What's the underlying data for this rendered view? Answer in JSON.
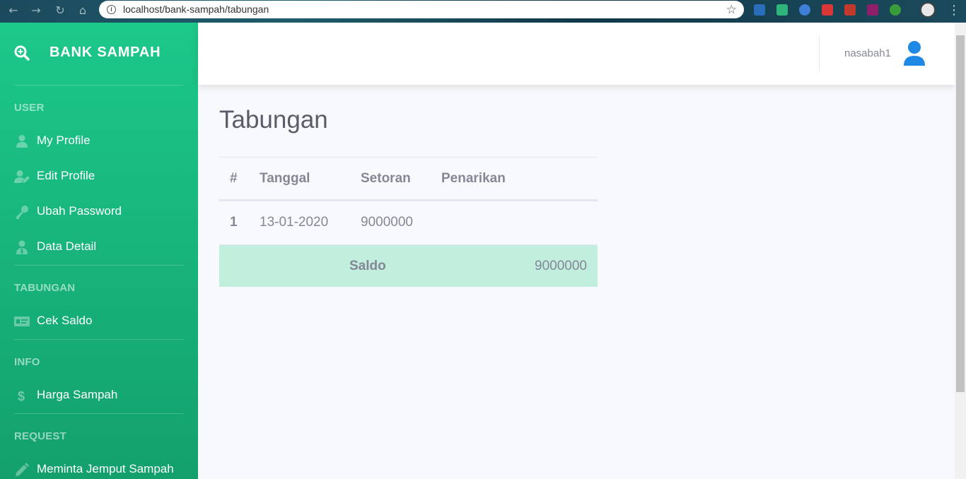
{
  "browser": {
    "url": "localhost/bank-sampah/tabungan"
  },
  "sidebar": {
    "brand": "BANK SAMPAH",
    "sections": [
      {
        "heading": "USER",
        "items": [
          {
            "label": "My Profile",
            "icon": "user-icon"
          },
          {
            "label": "Edit Profile",
            "icon": "user-edit-icon"
          },
          {
            "label": "Ubah Password",
            "icon": "key-icon"
          },
          {
            "label": "Data Detail",
            "icon": "user-tie-icon"
          }
        ]
      },
      {
        "heading": "TABUNGAN",
        "items": [
          {
            "label": "Cek Saldo",
            "icon": "id-card-icon"
          }
        ]
      },
      {
        "heading": "INFO",
        "items": [
          {
            "label": "Harga Sampah",
            "icon": "dollar-icon"
          }
        ]
      },
      {
        "heading": "REQUEST",
        "items": [
          {
            "label": "Meminta Jemput Sampah",
            "icon": "pencil-icon"
          }
        ]
      }
    ]
  },
  "topbar": {
    "username": "nasabah1"
  },
  "main": {
    "title": "Tabungan",
    "table": {
      "headers": [
        "#",
        "Tanggal",
        "Setoran",
        "Penarikan"
      ],
      "rows": [
        {
          "no": "1",
          "tanggal": "13-01-2020",
          "setoran": "9000000",
          "penarikan": ""
        }
      ],
      "saldo_label": "Saldo",
      "saldo_value": "9000000"
    }
  },
  "colors": {
    "sidebar_top": "#1cc88a",
    "sidebar_bottom": "#13a06d",
    "saldo_row": "#c1eedd",
    "avatar": "#1e88e5"
  }
}
